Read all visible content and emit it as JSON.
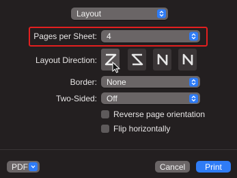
{
  "layout_section": {
    "label": "Layout"
  },
  "pages_per_sheet": {
    "label": "Pages per Sheet:",
    "value": "4"
  },
  "layout_direction": {
    "label": "Layout Direction:",
    "options": [
      "z-pattern",
      "reverse-z-pattern",
      "n-pattern",
      "reverse-n-pattern"
    ],
    "selected_index": 0
  },
  "border": {
    "label": "Border:",
    "value": "None"
  },
  "two_sided": {
    "label": "Two-Sided:",
    "value": "Off"
  },
  "reverse_orientation": {
    "label": "Reverse page orientation",
    "checked": false
  },
  "flip_horizontally": {
    "label": "Flip horizontally",
    "checked": false
  },
  "footer": {
    "pdf_label": "PDF",
    "cancel_label": "Cancel",
    "print_label": "Print"
  },
  "colors": {
    "accent": "#2f7cf6",
    "highlight": "#e41f1f",
    "background": "#231f20"
  }
}
